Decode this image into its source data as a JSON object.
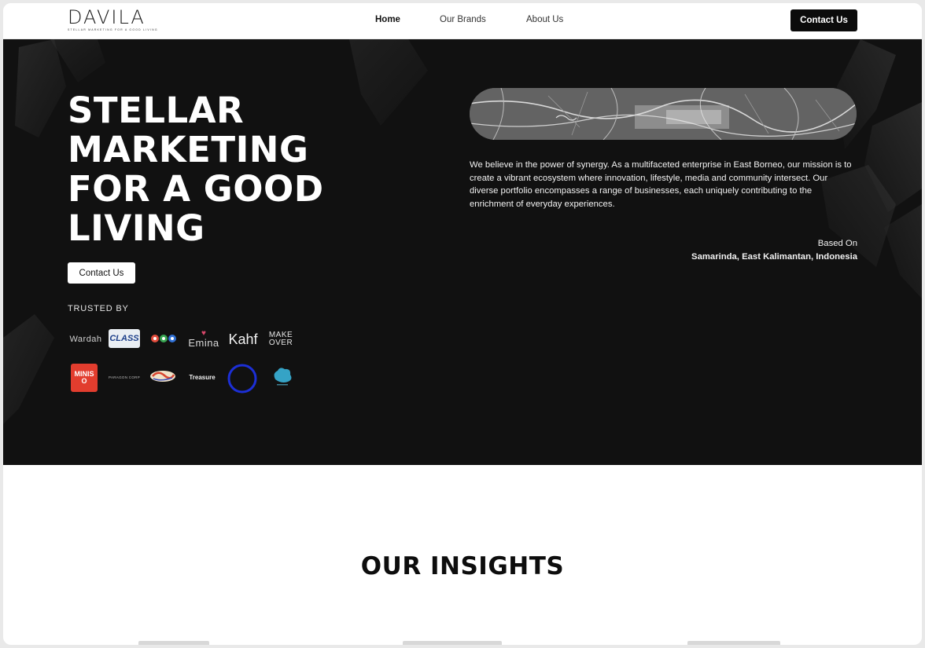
{
  "header": {
    "logo_word": "DAVILA",
    "logo_tagline": "STELLAR MARKETING FOR A GOOD LIVING",
    "nav": [
      {
        "label": "Home"
      },
      {
        "label": "Our Brands"
      },
      {
        "label": "About Us"
      }
    ],
    "cta_label": "Contact Us"
  },
  "hero": {
    "title_lines": [
      "STELLAR",
      "MARKETING",
      "FOR A GOOD",
      "LIVING"
    ],
    "cta_label": "Contact Us",
    "trusted_label": "TRUSTED BY",
    "brands_row1": [
      "Wardah",
      "CLASS",
      "Emina",
      "Kahf",
      "MAKE OVER"
    ],
    "brands_row2": [
      "MINISO",
      "PARAGON CORP",
      "Treasure"
    ],
    "mission": "We believe in the power of synergy. As a multifaceted enterprise in East Borneo, our mission is to create a vibrant ecosystem where innovation, lifestyle, media and community intersect. Our diverse portfolio encompasses a range of businesses, each uniquely contributing to the enrichment of everyday experiences.",
    "based_label": "Based On",
    "based_location": "Samarinda, East Kalimantan, Indonesia"
  },
  "insights": {
    "title": "OUR INSIGHTS"
  },
  "colors": {
    "hero_bg": "#111111",
    "header_cta_bg": "#0b0b0b",
    "accent_blue": "#1c2fd6",
    "miniso_red": "#e23d2e"
  }
}
